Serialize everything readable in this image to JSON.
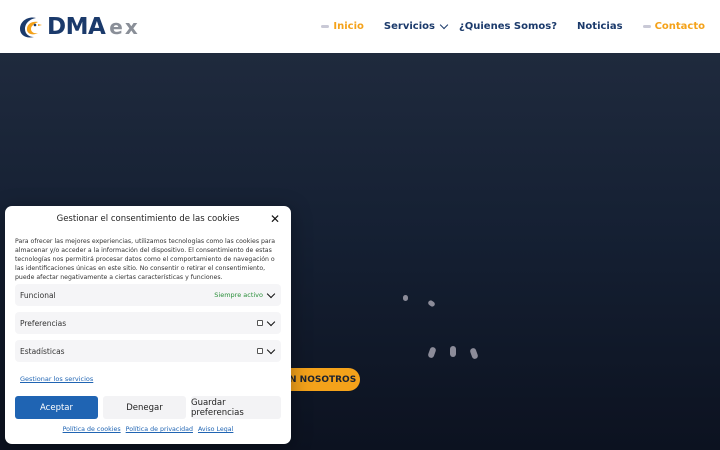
{
  "brand": {
    "name_main": "DMA",
    "name_suffix": "ex",
    "colors": {
      "primary": "#1b3a6b",
      "accent": "#f4a21a",
      "grey": "#8a8f98"
    }
  },
  "nav": {
    "items": [
      {
        "label": "Inicio",
        "active": true
      },
      {
        "label": "Servicios",
        "has_dropdown": true
      },
      {
        "label": "¿Quienes Somos?"
      },
      {
        "label": "Noticias"
      },
      {
        "label": "Contacto",
        "highlight": true
      }
    ]
  },
  "hero": {
    "button_label": "N NOSOTROS",
    "loader_icon": "spinner-icon"
  },
  "cookie_modal": {
    "title": "Gestionar el consentimiento de las cookies",
    "close_icon": "close-icon",
    "description": "Para ofrecer las mejores experiencias, utilizamos tecnologías como las cookies para almacenar y/o acceder a la información del dispositivo. El consentimiento de estas tecnologías nos permitirá procesar datos como el comportamiento de navegación o las identificaciones únicas en este sitio. No consentir o retirar el consentimiento, puede afectar negativamente a ciertas características y funciones.",
    "categories": [
      {
        "label": "Funcional",
        "status": "Siempre activo"
      },
      {
        "label": "Preferencias"
      },
      {
        "label": "Estadísticas"
      }
    ],
    "manage_link": "Gestionar los servicios",
    "buttons": {
      "accept": "Aceptar",
      "deny": "Denegar",
      "preferences": "Guardar preferencias"
    },
    "footer_links": [
      "Política de cookies",
      "Política de privacidad",
      "Aviso Legal"
    ]
  }
}
